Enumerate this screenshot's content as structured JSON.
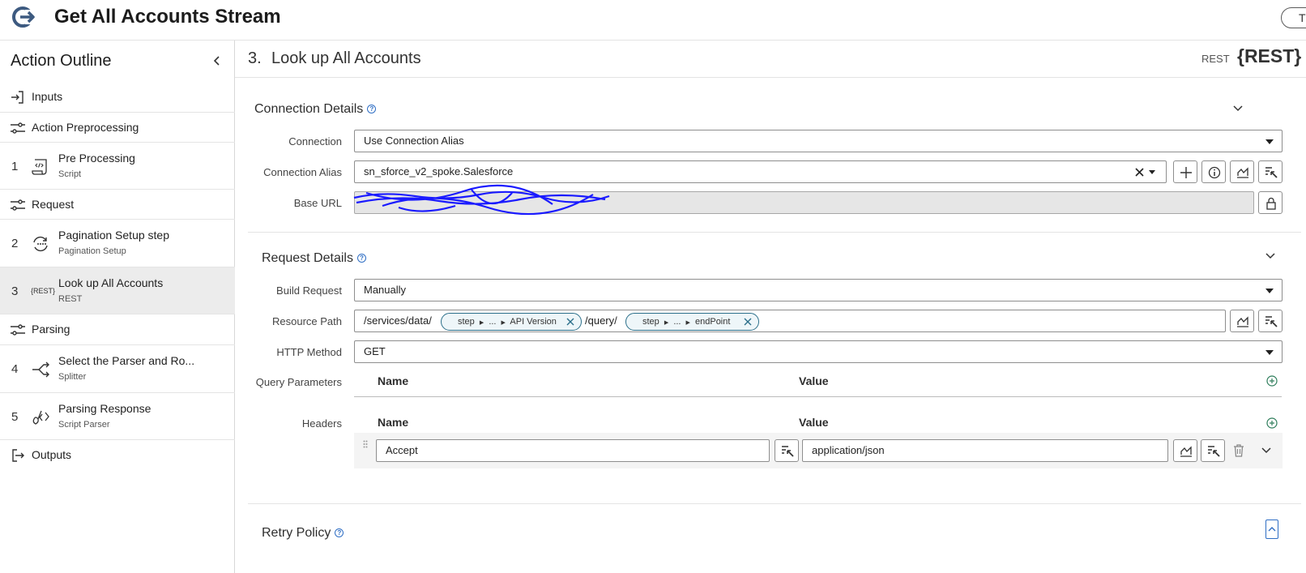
{
  "header": {
    "title": "Get All Accounts Stream",
    "right_button_label": "T"
  },
  "sidebar": {
    "title": "Action Outline",
    "items": [
      {
        "num": "",
        "label": "Inputs",
        "sub": "",
        "icon": "input-arrow-icon"
      },
      {
        "num": "",
        "label": "Action Preprocessing",
        "sub": "",
        "icon": "sliders-icon"
      },
      {
        "num": "1",
        "label": "Pre Processing",
        "sub": "Script",
        "icon": "script-icon"
      },
      {
        "num": "",
        "label": "Request",
        "sub": "",
        "icon": "sliders-icon"
      },
      {
        "num": "2",
        "label": "Pagination Setup step",
        "sub": "Pagination Setup",
        "icon": "pagination-icon"
      },
      {
        "num": "3",
        "label": "Look up All Accounts",
        "sub": "REST",
        "icon": "rest-icon",
        "icon_text": "{REST}"
      },
      {
        "num": "",
        "label": "Parsing",
        "sub": "",
        "icon": "sliders-icon"
      },
      {
        "num": "4",
        "label": "Select the Parser and Ro...",
        "sub": "Splitter",
        "icon": "splitter-icon"
      },
      {
        "num": "5",
        "label": "Parsing Response",
        "sub": "Script Parser",
        "icon": "script-parser-icon"
      },
      {
        "num": "",
        "label": "Outputs",
        "sub": "",
        "icon": "output-arrow-icon"
      }
    ]
  },
  "main": {
    "step_number": "3.",
    "step_title": "Look up All Accounts",
    "type_label": "REST",
    "type_logo": "{REST}",
    "connection_details": {
      "title": "Connection Details",
      "connection_label": "Connection",
      "connection_value": "Use Connection Alias",
      "alias_label": "Connection Alias",
      "alias_value": "sn_sforce_v2_spoke.Salesforce",
      "base_url_label": "Base URL",
      "base_url_value": ""
    },
    "request_details": {
      "title": "Request Details",
      "build_request_label": "Build Request",
      "build_request_value": "Manually",
      "resource_path_label": "Resource Path",
      "resource_path_seg1": "/services/data/",
      "pill1": {
        "step": "step",
        "ellipsis": "...",
        "name": "API Version"
      },
      "resource_path_seg2": "/query/",
      "pill2": {
        "step": "step",
        "ellipsis": "...",
        "name": "endPoint"
      },
      "http_method_label": "HTTP Method",
      "http_method_value": "GET",
      "query_params_label": "Query Parameters",
      "headers_label": "Headers",
      "col_name": "Name",
      "col_value": "Value",
      "header_rows": [
        {
          "name": "Accept",
          "value": "application/json"
        }
      ]
    },
    "retry_policy": {
      "title": "Retry Policy"
    }
  },
  "colors": {
    "accent": "#2f6ec4",
    "pill_border": "#2b6f8a",
    "redaction": "#1a1aff",
    "selected_bg": "#ececec"
  }
}
